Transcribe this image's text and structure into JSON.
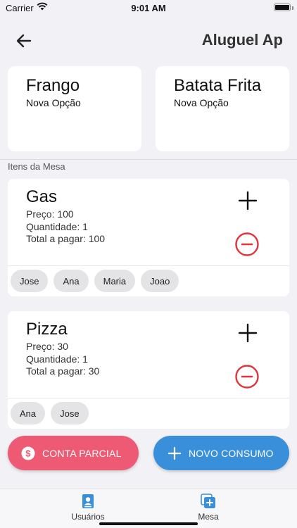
{
  "status_bar": {
    "carrier": "Carrier",
    "time": "9:01 AM"
  },
  "header": {
    "title": "Aluguel Ap",
    "back_icon": "arrow-left-icon"
  },
  "options": [
    {
      "title": "Frango",
      "subtitle": "Nova Opção"
    },
    {
      "title": "Batata Frita",
      "subtitle": "Nova Opção"
    }
  ],
  "section_label": "Itens da Mesa",
  "items": [
    {
      "name": "Gas",
      "price": "Preço: 100",
      "quantity": "Quantidade: 1",
      "total": "Total a pagar: 100",
      "people": [
        "Jose",
        "Ana",
        "Maria",
        "Joao"
      ]
    },
    {
      "name": "Pizza",
      "price": "Preço: 30",
      "quantity": "Quantidade: 1",
      "total": "Total a pagar: 30",
      "people": [
        "Ana",
        "Jose"
      ]
    }
  ],
  "actions": {
    "partial_label": "CONTA PARCIAL",
    "partial_icon": "dollar-circle-icon",
    "novo_label": "NOVO CONSUMO",
    "novo_icon": "plus-icon"
  },
  "tabs": [
    {
      "label": "Usuários",
      "icon": "contacts-icon"
    },
    {
      "label": "Mesa",
      "icon": "add-stack-icon"
    }
  ],
  "colors": {
    "partial": "#ee5a74",
    "novo": "#3a8fdb",
    "remove": "#e0333b",
    "tab_icon": "#3a8fdb"
  }
}
